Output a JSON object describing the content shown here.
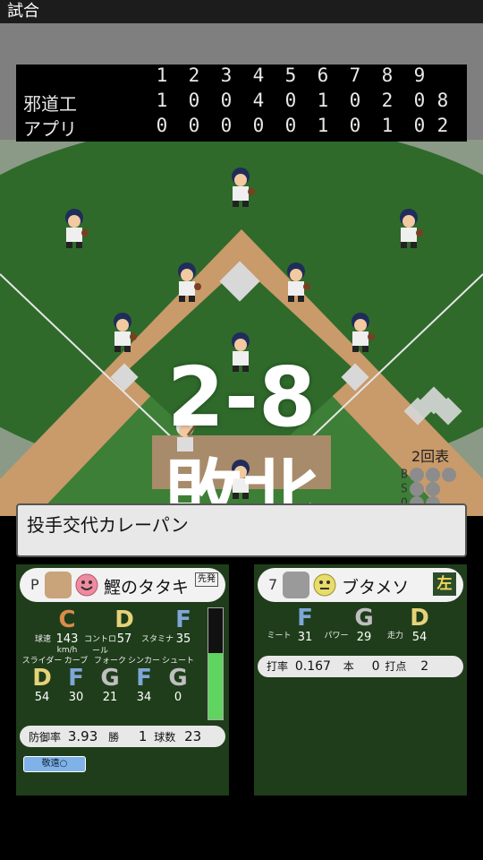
{
  "window": {
    "title": "試合"
  },
  "scoreboard": {
    "innings": [
      "1",
      "2",
      "3",
      "4",
      "5",
      "6",
      "7",
      "8",
      "9"
    ],
    "teams": [
      {
        "name": "邪道工",
        "scores": [
          "1",
          "0",
          "0",
          "4",
          "0",
          "1",
          "0",
          "2",
          "0"
        ],
        "total": "8"
      },
      {
        "name": "アプリ",
        "scores": [
          "0",
          "0",
          "0",
          "0",
          "0",
          "1",
          "0",
          "1",
          "0"
        ],
        "total": "2"
      }
    ]
  },
  "result": {
    "score": "2-8",
    "outcome": "敗北"
  },
  "game_state": {
    "inning": "2回表",
    "count_labels": [
      "B",
      "S",
      "O"
    ]
  },
  "message": "投手交代カレーパン",
  "pitcher": {
    "position": "P",
    "name": "鰹のタタキ",
    "tag": "先発",
    "stats": [
      {
        "label": "球速",
        "grade": "C",
        "value": "143",
        "unit": "km/h"
      },
      {
        "label": "コントロール",
        "grade": "D",
        "value": "57"
      },
      {
        "label": "スタミナ",
        "grade": "F",
        "value": "35"
      }
    ],
    "pitches": [
      {
        "label": "スライダー",
        "grade": "D",
        "value": "54"
      },
      {
        "label": "カーブ",
        "grade": "F",
        "value": "30"
      },
      {
        "label": "フォーク",
        "grade": "G",
        "value": "21"
      },
      {
        "label": "シンカー",
        "grade": "F",
        "value": "34"
      },
      {
        "label": "シュート",
        "grade": "G",
        "value": "0"
      }
    ],
    "era_label": "防御率",
    "era": "3.93",
    "wins_label": "勝",
    "wins": "1",
    "pitch_count_label": "球数",
    "pitch_count": "23",
    "walk_button": "敬遠○"
  },
  "batter": {
    "number": "7",
    "name": "ブタメソ",
    "hand": "左",
    "stats": [
      {
        "label": "ミート",
        "grade": "F",
        "value": "31"
      },
      {
        "label": "パワー",
        "grade": "G",
        "value": "29"
      },
      {
        "label": "走力",
        "grade": "D",
        "value": "54"
      }
    ],
    "avg_label": "打率",
    "avg": "0.167",
    "hr_label": "本",
    "hr": "0",
    "rbi_label": "打点",
    "rbi": "2"
  },
  "colors": {
    "field_dark": "#2f6a2b",
    "field_light": "#3d7f37",
    "dirt": "#c99a6a",
    "panel": "#1f3d1b",
    "overlay": "#7f7f7f"
  }
}
